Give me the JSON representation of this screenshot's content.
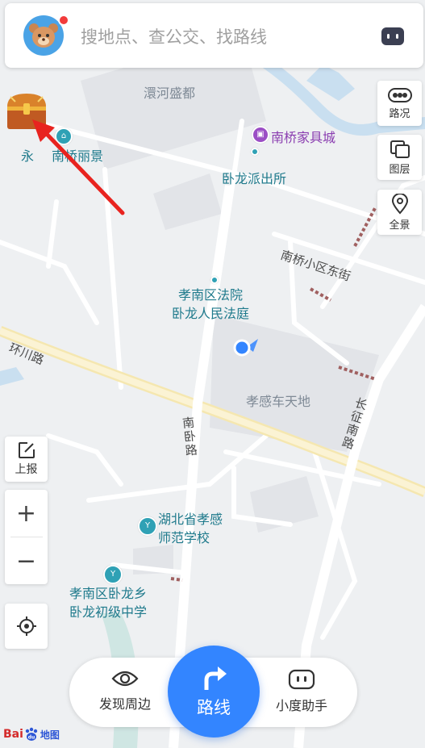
{
  "search": {
    "placeholder": "搜地点、查公交、找路线"
  },
  "right_controls": [
    {
      "label": "路况",
      "icon": "traffic-icon"
    },
    {
      "label": "图层",
      "icon": "layers-icon"
    },
    {
      "label": "全景",
      "icon": "panorama-pin-icon"
    }
  ],
  "left_controls": {
    "report_label": "上报",
    "zoom_in": "+",
    "zoom_out": "−"
  },
  "map_labels": {
    "huanhe": "澴河盛都",
    "nanqiao_furniture": "南桥家具城",
    "yonghe": "永",
    "nanqiao_liying": "南桥丽景",
    "wolong_police": "卧龙派出所",
    "nanqiao_east_st": "南桥小区东街",
    "xiaonan_court": "孝南区法院",
    "wolong_court": "卧龙人民法庭",
    "huanchuan_rd": "环川路",
    "xiaogan_chetiandi": "孝感车天地",
    "changzheng_rd": "长征南路",
    "nanwo_rd": "南卧路",
    "hubei_normal_1": "湖北省孝感",
    "hubei_normal_2": "师范学校",
    "wolong_school_1": "孝南区卧龙乡",
    "wolong_school_2": "卧龙初级中学"
  },
  "bottom_bar": {
    "discover_label": "发现周边",
    "route_label": "路线",
    "assistant_label": "小度助手"
  },
  "logo": {
    "brand": "Bai",
    "paw": "du",
    "suffix": "地图"
  },
  "colors": {
    "accent_blue": "#3385ff",
    "poi_teal": "#2fa1b5",
    "poi_purple": "#9b4ec5",
    "arrow_red": "#e8231f",
    "main_road": "#f5e7b0"
  }
}
